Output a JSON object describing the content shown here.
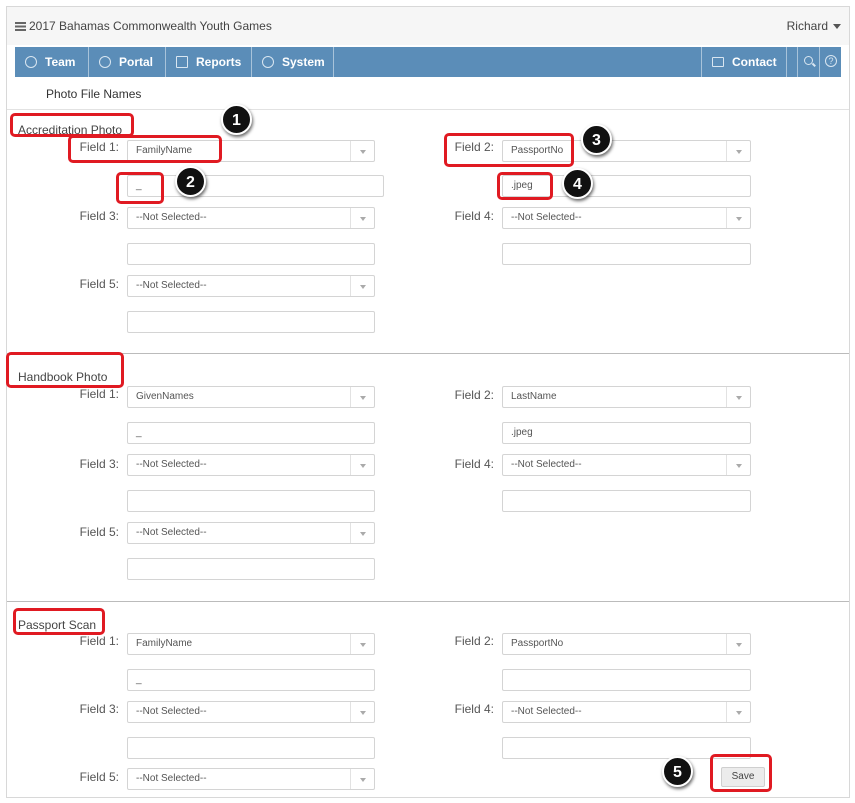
{
  "app": {
    "title": "2017 Bahamas Commonwealth Youth Games",
    "user": "Richard"
  },
  "nav": {
    "items": [
      {
        "label": "Team",
        "icon": "team-icon"
      },
      {
        "label": "Portal",
        "icon": "globe-icon"
      },
      {
        "label": "Reports",
        "icon": "report-icon"
      },
      {
        "label": "System",
        "icon": "gear-icon"
      }
    ],
    "contact": "Contact",
    "search_icon": "search-icon",
    "help_icon": "help-icon"
  },
  "page": {
    "title": "Photo File Names"
  },
  "labels": {
    "f1": "Field 1:",
    "f2": "Field 2:",
    "f3": "Field 3:",
    "f4": "Field 4:",
    "f5": "Field 5:"
  },
  "sections": {
    "accreditation": {
      "title": "Accreditation Photo",
      "f1": "FamilyName",
      "f1_text": "_",
      "f2": "PassportNo",
      "f2_text": ".jpeg",
      "f3": "--Not Selected--",
      "f3_text": "",
      "f4": "--Not Selected--",
      "f4_text": "",
      "f5": "--Not Selected--",
      "f5_text": ""
    },
    "handbook": {
      "title": "Handbook Photo",
      "f1": "GivenNames",
      "f1_text": "_",
      "f2": "LastName",
      "f2_text": ".jpeg",
      "f3": "--Not Selected--",
      "f3_text": "",
      "f4": "--Not Selected--",
      "f4_text": "",
      "f5": "--Not Selected--",
      "f5_text": ""
    },
    "passport": {
      "title": "Passport Scan",
      "f1": "FamilyName",
      "f1_text": "_",
      "f2": "PassportNo",
      "f2_text": "",
      "f3": "--Not Selected--",
      "f3_text": "",
      "f4": "--Not Selected--",
      "f4_text": "",
      "f5": "--Not Selected--"
    }
  },
  "actions": {
    "save": "Save"
  },
  "annotations": {
    "b1": "1",
    "b2": "2",
    "b3": "3",
    "b4": "4",
    "b5": "5"
  },
  "colors": {
    "nav_bg": "#5b8db8",
    "highlight": "#e01a22",
    "badge": "#111111"
  }
}
